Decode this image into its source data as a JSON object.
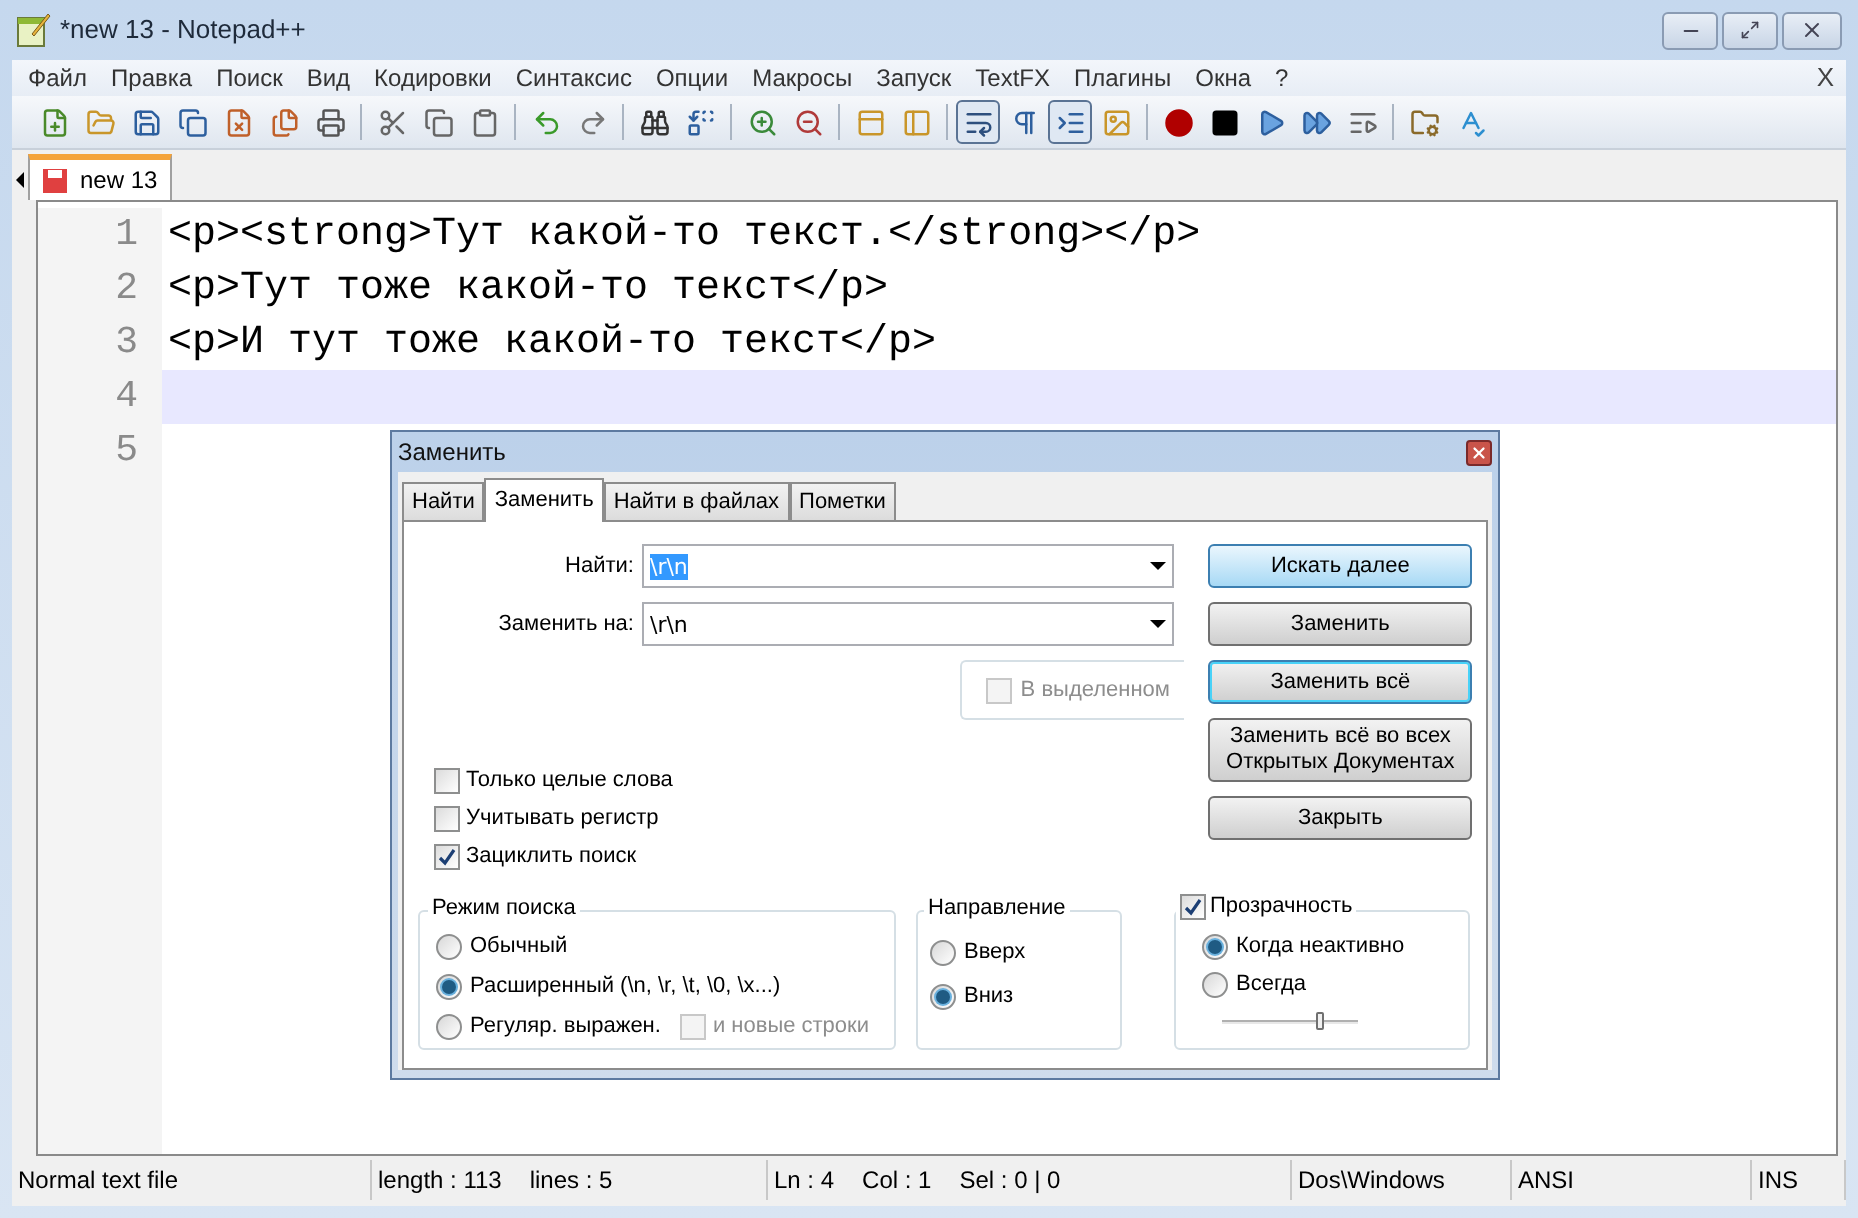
{
  "window": {
    "title": "*new 13 - Notepad++"
  },
  "menu": [
    "Файл",
    "Правка",
    "Поиск",
    "Вид",
    "Кодировки",
    "Синтаксис",
    "Опции",
    "Макросы",
    "Запуск",
    "TextFX",
    "Плагины",
    "Окна",
    "?"
  ],
  "menu_close": "X",
  "toolbar": {
    "wrap_pressed": true,
    "guides_pressed": true
  },
  "tabs": [
    {
      "label": "new 13",
      "selected": true,
      "modified": true
    }
  ],
  "editor": {
    "lines": [
      {
        "number": "1",
        "text": "<p><strong>Тут какой-то текст.</strong></p>",
        "current": false
      },
      {
        "number": "2",
        "text": "<p>Тут тоже какой-то текст</p>",
        "current": false
      },
      {
        "number": "3",
        "text": "<p>И тут тоже какой-то текст</p>",
        "current": false
      },
      {
        "number": "4",
        "current": true
      },
      {
        "number": "5",
        "current": false
      }
    ]
  },
  "dialog": {
    "title": "Заменить",
    "tabs": [
      {
        "label": "Найти",
        "selected": false
      },
      {
        "label": "Заменить",
        "selected": true
      },
      {
        "label": "Найти в файлах",
        "selected": false
      },
      {
        "label": "Пометки",
        "selected": false
      }
    ],
    "fields": [
      {
        "label": "Найти:",
        "value": "\\r\\n",
        "text_selected": true
      },
      {
        "label": "Заменить на:",
        "value": "\\r\\n",
        "text_selected": false
      }
    ],
    "in_selection": {
      "label": "В выделенном",
      "checked": false,
      "disabled": true
    },
    "buttons": [
      {
        "label": "Искать далее",
        "kind": "default"
      },
      {
        "label": "Заменить",
        "kind": "normal"
      },
      {
        "label": "Заменить всё",
        "kind": "focused"
      },
      {
        "lines": [
          "Заменить всё во всех",
          "Открытых Документах"
        ],
        "kind": "normal"
      },
      {
        "label": "Закрыть",
        "kind": "normal"
      }
    ],
    "options": [
      {
        "label": "Только целые слова",
        "checked": false
      },
      {
        "label": "Учитывать регистр",
        "checked": false
      },
      {
        "label": "Зациклить поиск",
        "checked": true
      }
    ],
    "search_mode": {
      "title": "Режим поиска",
      "options": [
        {
          "label": "Обычный",
          "selected": false
        },
        {
          "label": "Расширенный (\\n, \\r, \\t, \\0, \\x...)",
          "selected": true
        },
        {
          "label": "Регуляр. выражен.",
          "selected": false
        }
      ],
      "newlines": {
        "label": "и новые строки",
        "checked": false,
        "disabled": true
      }
    },
    "direction": {
      "title": "Направление",
      "options": [
        {
          "label": "Вверх",
          "selected": false
        },
        {
          "label": "Вниз",
          "selected": true
        }
      ]
    },
    "transparency": {
      "label": "Прозрачность",
      "checked": true,
      "options": [
        {
          "label": "Когда неактивно",
          "selected": true
        },
        {
          "label": "Всегда",
          "selected": false
        }
      ],
      "level": 0.72
    }
  },
  "status_bar": [
    [
      "Normal text file"
    ],
    [
      "length : 113",
      "lines : 5"
    ],
    [
      "Ln : 4",
      "Col : 1",
      "Sel : 0 | 0"
    ],
    [
      "Dos\\Windows"
    ],
    [
      "ANSI"
    ],
    [
      "INS"
    ]
  ]
}
